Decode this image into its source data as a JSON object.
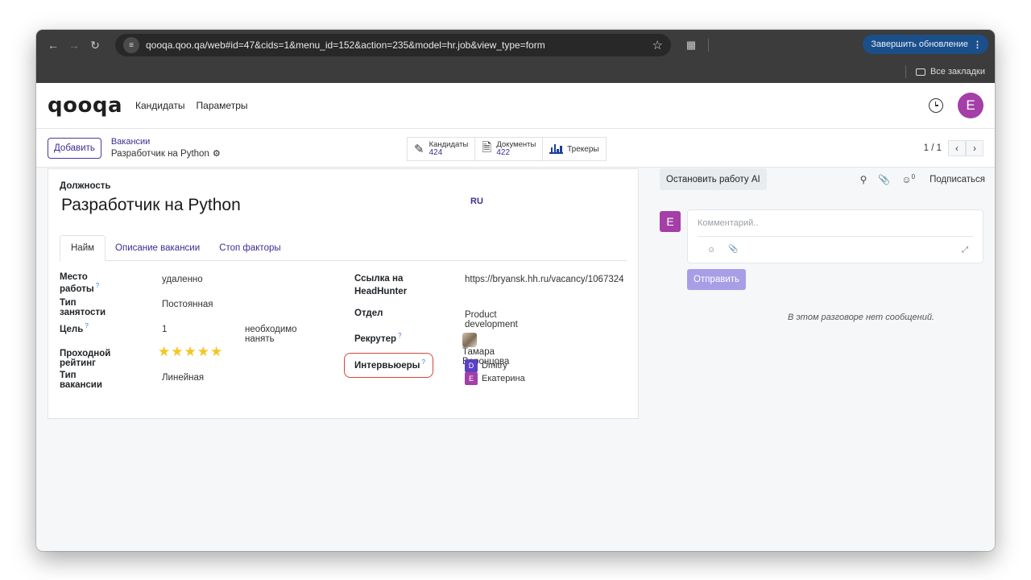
{
  "browser": {
    "url": "qooqa.qoo.qa/web#id=47&cids=1&menu_id=152&action=235&model=hr.job&view_type=form",
    "update_button": "Завершить обновление",
    "bookmarks_label": "Все закладки"
  },
  "app": {
    "logo": "qooqa",
    "menu": [
      "Кандидаты",
      "Параметры"
    ],
    "user_initial": "E",
    "user_color": "#a33fa7"
  },
  "control_panel": {
    "add_button": "Добавить",
    "breadcrumb_parent": "Вакансии",
    "breadcrumb_current": "Разработчик на Python",
    "smart_buttons": {
      "candidates_label": "Кандидаты",
      "candidates_count": "424",
      "documents_label": "Документы",
      "documents_count": "422",
      "trackers_label": "Трекеры"
    },
    "pager": "1 / 1"
  },
  "form": {
    "position_label": "Должность",
    "title": "Разработчик на Python",
    "lang": "RU",
    "tabs": [
      "Найм",
      "Описание вакансии",
      "Стоп факторы"
    ],
    "left": {
      "workplace_label": "Место работы",
      "workplace_value": "удаленно",
      "employment_label": "Тип занятости",
      "employment_value": "Постоянная",
      "target_label": "Цель",
      "target_value": "1",
      "target_suffix": "необходимо нанять",
      "rating_label": "Проходной рейтинг",
      "rating_value": 5,
      "vacancy_type_label": "Тип вакансии",
      "vacancy_type_value": "Линейная"
    },
    "right": {
      "hh_label": "Ссылка на HeadHunter",
      "hh_value": "https://bryansk.hh.ru/vacancy/1067324",
      "dept_label": "Отдел",
      "dept_value": "Product development",
      "recruiter_label": "Рекрутер",
      "recruiter_value": "Тамара Воронцова",
      "interviewers_label": "Интервьюеры",
      "interviewers": [
        {
          "initial": "D",
          "name": "Dmitry",
          "color": "#5b3fc4"
        },
        {
          "initial": "E",
          "name": "Екатерина",
          "color": "#a33fa7"
        }
      ]
    }
  },
  "chatter": {
    "stop_ai": "Остановить работу AI",
    "followers_count": "0",
    "follow": "Подписаться",
    "comment_placeholder": "Комментарий..",
    "send": "Отправить",
    "no_messages": "В этом разговоре нет сообщений."
  }
}
